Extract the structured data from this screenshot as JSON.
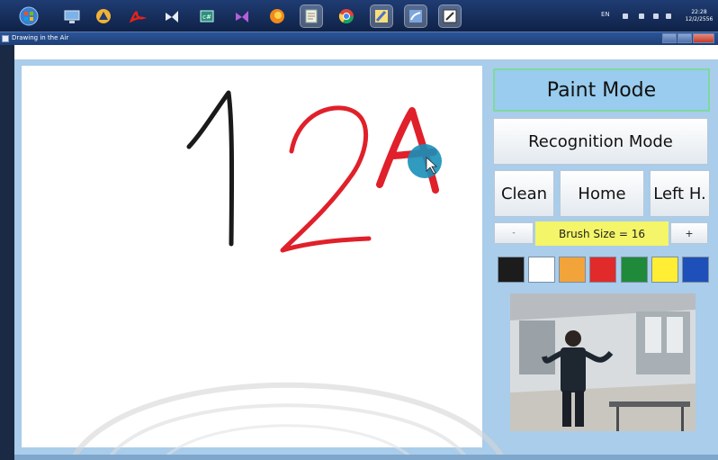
{
  "window": {
    "title": "Drawing in the Air"
  },
  "taskbar": {
    "icons": [
      "start-orb-icon",
      "computer-icon",
      "warning-icon",
      "pdf-icon",
      "visual-studio-icon",
      "csharp-icon",
      "visual-studio-purple-icon",
      "firefox-icon",
      "notepad-icon",
      "chrome-icon",
      "paint-brush-icon",
      "blender-icon",
      "drawing-app-icon"
    ],
    "language": "EN",
    "clock_time": "22:28",
    "clock_date": "12/2/2556"
  },
  "panel": {
    "paint_mode": "Paint Mode",
    "recognition_mode": "Recognition Mode",
    "clean": "Clean",
    "home": "Home",
    "left_hand": "Left H.",
    "minus": "-",
    "plus": "+",
    "brush_size": "Brush Size = 16"
  },
  "palette": {
    "colors": [
      "#1c1c1c",
      "#ffffff",
      "#f2a43a",
      "#e12a2a",
      "#1e8a3a",
      "#ffee33",
      "#1f4fb8"
    ]
  },
  "canvas": {
    "cursor_color": "#1a8fb8",
    "stroke_colors": [
      "#1a1a1a",
      "#e0202a"
    ]
  }
}
